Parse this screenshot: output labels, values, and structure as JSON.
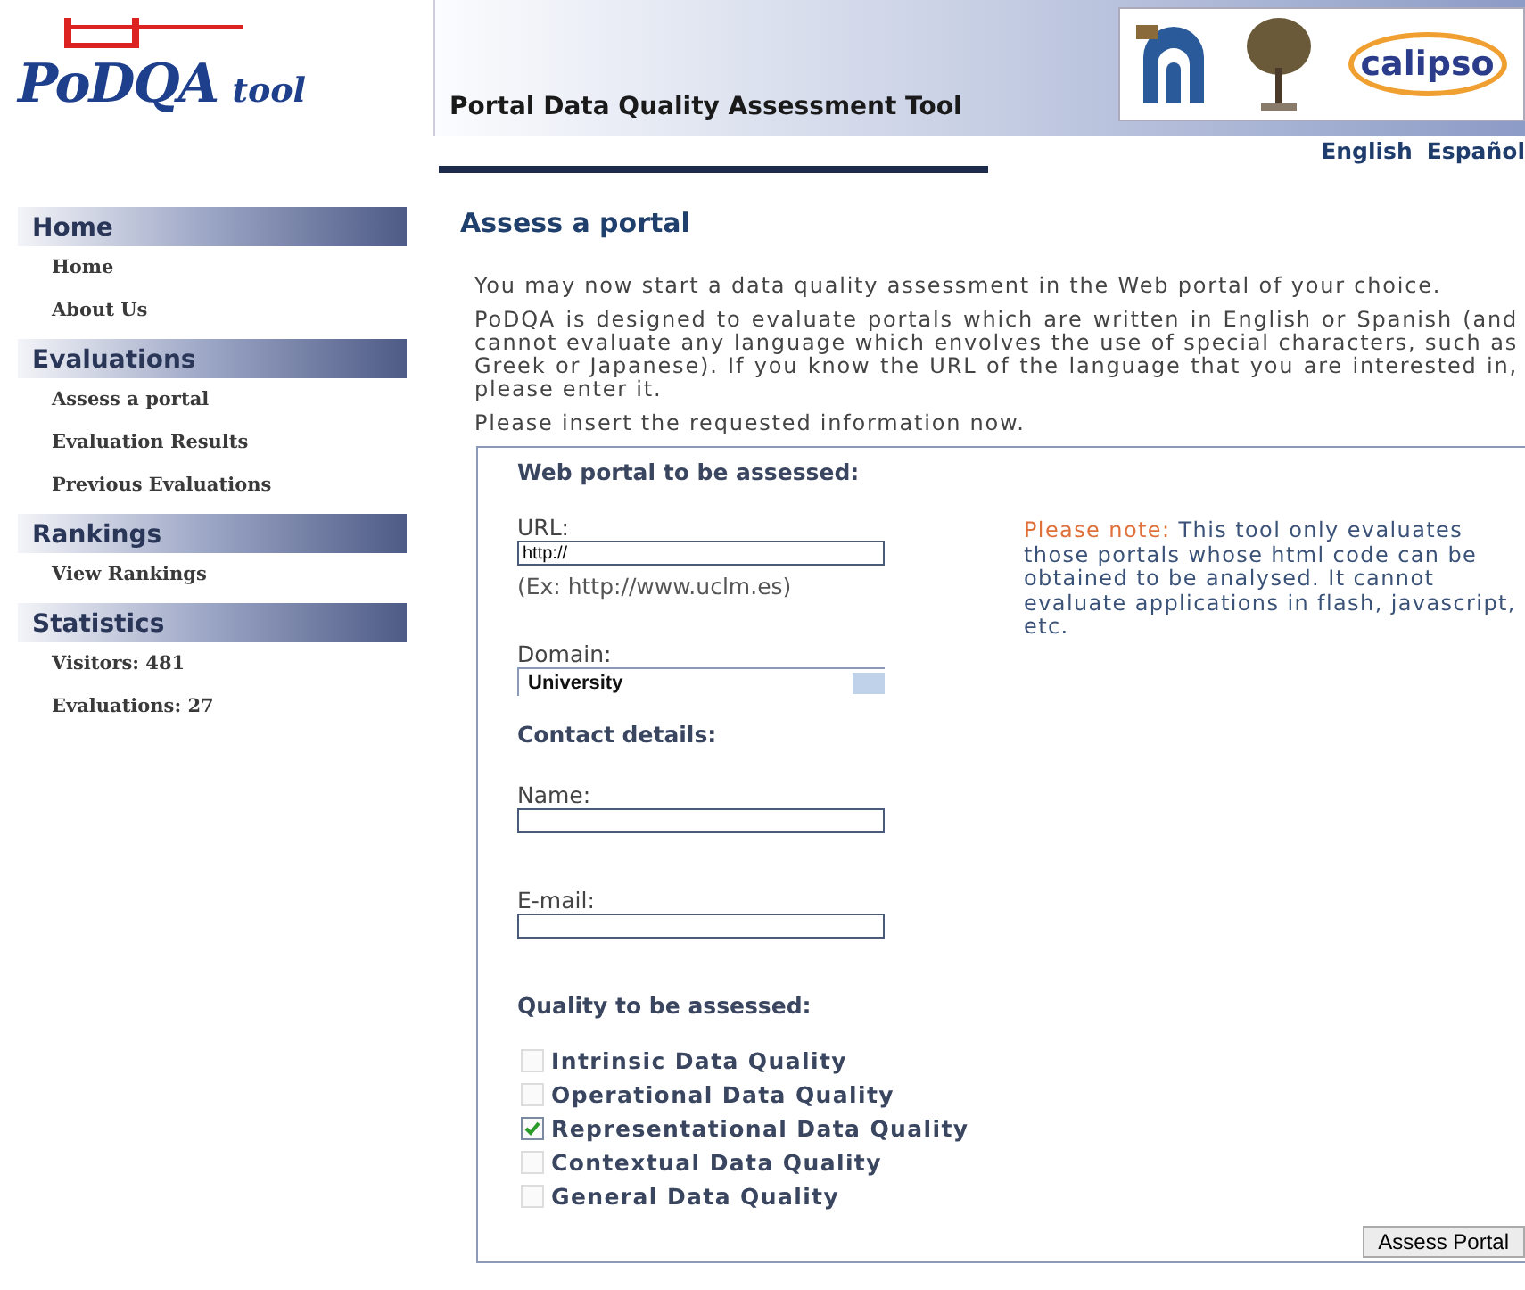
{
  "logo": {
    "name": "PoDQA",
    "suffix": "tool"
  },
  "banner": {
    "title": "Portal Data Quality Assessment Tool",
    "partner_logo": "calipso"
  },
  "languages": [
    {
      "label": "English"
    },
    {
      "label": "Español"
    }
  ],
  "sidebar": [
    {
      "heading": "Home",
      "items": [
        "Home",
        "About Us"
      ]
    },
    {
      "heading": "Evaluations",
      "items": [
        "Assess a portal",
        "Evaluation Results",
        "Previous Evaluations"
      ]
    },
    {
      "heading": "Rankings",
      "items": [
        "View Rankings"
      ]
    },
    {
      "heading": "Statistics",
      "items": [
        "Visitors: 481",
        "Evaluations: 27"
      ]
    }
  ],
  "page_title": "Assess a portal",
  "intro": [
    "You may now start a data quality assessment in the Web portal of your choice.",
    "PoDQA is designed to evaluate portals which are written in English or Spanish (and cannot evaluate any language which envolves the use of special characters, such as Greek or Japanese). If you know the URL of the language that you are interested in, please enter it.",
    "Please insert the requested information now."
  ],
  "form": {
    "section_title": "Web portal to be assessed:",
    "url": {
      "label": "URL:",
      "value": "http://",
      "hint": "(Ex: http://www.uclm.es)"
    },
    "domain": {
      "label": "Domain:",
      "value": "University"
    },
    "note": {
      "lead": "Please note:",
      "text": "This tool only evaluates those portals whose html code can be obtained to be analysed. It cannot evaluate applications in flash, javascript, etc."
    },
    "contact_title": "Contact details:",
    "name": {
      "label": "Name:"
    },
    "email": {
      "label": "E-mail:"
    },
    "quality_title": "Quality to be assessed:",
    "qualities": [
      {
        "label": "Intrinsic Data Quality",
        "checked": false
      },
      {
        "label": "Operational Data Quality",
        "checked": false
      },
      {
        "label": "Representational Data Quality",
        "checked": true
      },
      {
        "label": "Contextual Data Quality",
        "checked": false
      },
      {
        "label": "General Data Quality",
        "checked": false
      }
    ],
    "submit": "Assess Portal"
  }
}
